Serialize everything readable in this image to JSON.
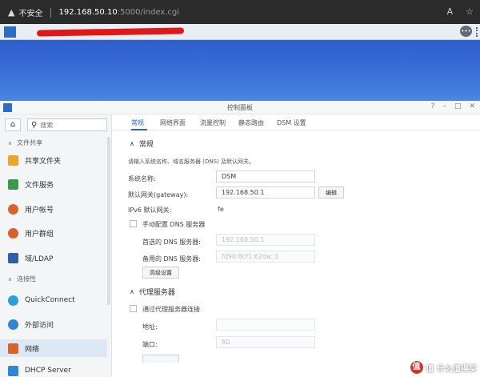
{
  "browser": {
    "insecure_label": "不安全",
    "url_host": "192.168.50.10",
    "url_path": ":5000/index.cgi"
  },
  "window": {
    "title": "控制面板"
  },
  "sidebar": {
    "search_placeholder": "搜索",
    "sections": {
      "file_sharing": "文件共享",
      "connectivity": "连接性"
    },
    "items": [
      {
        "label": "共享文件夹",
        "icon_color": "#e8a825"
      },
      {
        "label": "文件服务",
        "icon_color": "#3a9a4a"
      },
      {
        "label": "用户帐号",
        "icon_color": "#d9622a"
      },
      {
        "label": "用户群组",
        "icon_color": "#d9622a"
      },
      {
        "label": "域/LDAP",
        "icon_color": "#2f5ea8"
      },
      {
        "label": "QuickConnect",
        "icon_color": "#2aa0d9"
      },
      {
        "label": "外部访问",
        "icon_color": "#2f86d6"
      },
      {
        "label": "网络",
        "icon_color": "#d9622a"
      },
      {
        "label": "DHCP Server",
        "icon_color": "#2f86d6"
      }
    ]
  },
  "tabs": [
    "常规",
    "网络界面",
    "流量控制",
    "静态路由",
    "DSM 设置"
  ],
  "general": {
    "section_title": "常规",
    "description": "请输入系统名称、域名服务器 (DNS) 及默认网关。",
    "server_name_label": "系统名称:",
    "server_name_value": "DSM",
    "gateway_label": "默认网关(gateway):",
    "gateway_value": "192.168.50.1",
    "edit_button": "编辑",
    "ipv6_label": "IPv6 默认网关:",
    "ipv6_value": "fe",
    "manual_dns_label": "手动配置 DNS 服务器",
    "preferred_dns_label": "首选的 DNS 服务器:",
    "preferred_dns_value": "192.168.50.1",
    "alternate_dns_label": "备用的 DNS 服务器:",
    "alternate_dns_value": "fd90:8cf1:62da::1",
    "advanced_button": "高级设置"
  },
  "proxy": {
    "section_title": "代理服务器",
    "connect_via_proxy_label": "通过代理服务器连接",
    "address_label": "地址:",
    "address_value": "",
    "port_label": "端口:",
    "port_value": "80"
  },
  "watermark": {
    "text": "值 什么值得买"
  }
}
